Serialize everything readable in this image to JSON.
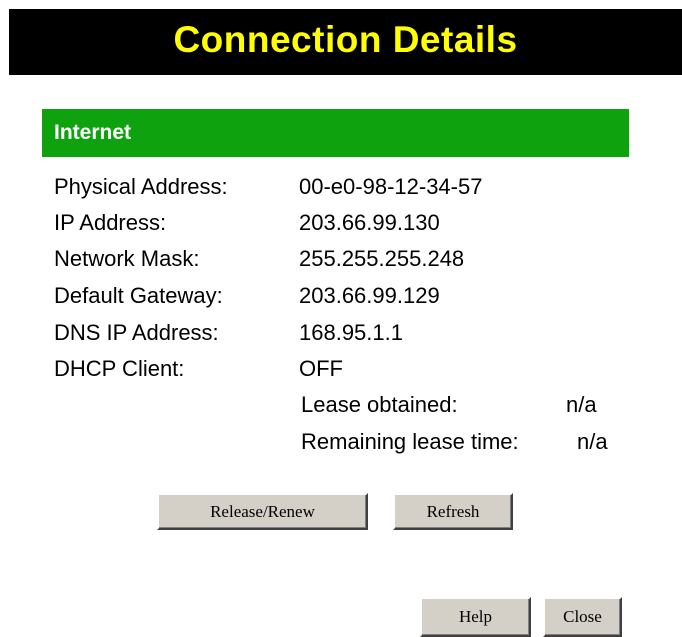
{
  "page": {
    "title": "Connection Details",
    "title_color": "#ffff00",
    "title_bg": "#000000"
  },
  "section": {
    "title": "Internet",
    "header_color": "#0ea30e"
  },
  "details": {
    "physical_address": {
      "label": "Physical Address:",
      "value": "00-e0-98-12-34-57"
    },
    "ip_address": {
      "label": "IP Address:",
      "value": "203.66.99.130"
    },
    "network_mask": {
      "label": "Network Mask:",
      "value": "255.255.255.248"
    },
    "default_gateway": {
      "label": "Default Gateway:",
      "value": "203.66.99.129"
    },
    "dns_ip_address": {
      "label": "DNS IP Address:",
      "value": "168.95.1.1"
    },
    "dhcp_client": {
      "label": "DHCP Client:",
      "value": "OFF"
    },
    "lease_obtained": {
      "label": "Lease obtained:",
      "value": "n/a"
    },
    "remaining_lease_time": {
      "label": "Remaining lease time:",
      "value": "n/a"
    }
  },
  "buttons": {
    "release_renew": "Release/Renew",
    "refresh": "Refresh",
    "help": "Help",
    "close": "Close"
  }
}
